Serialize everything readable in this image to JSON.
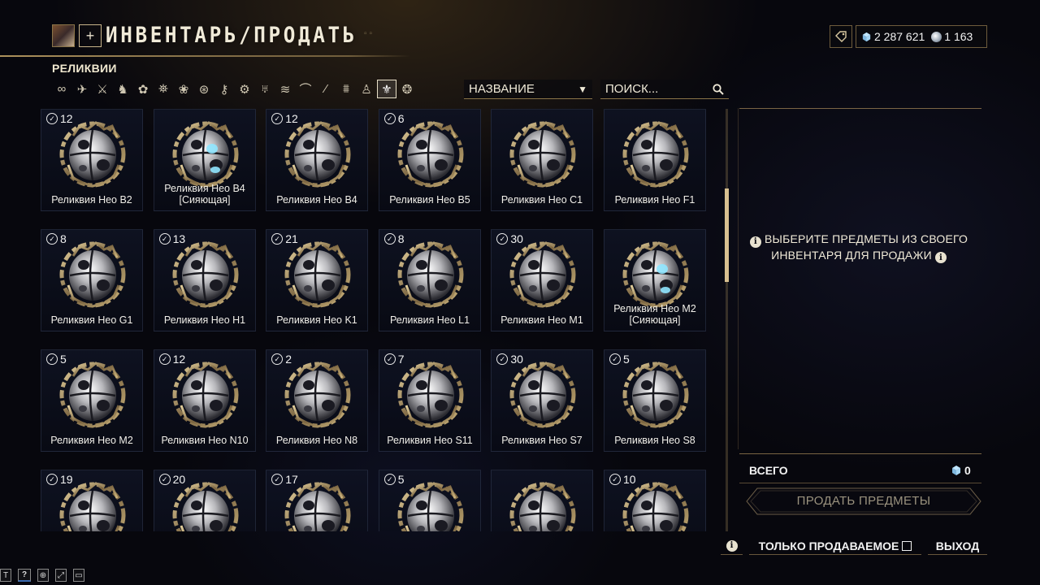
{
  "header": {
    "plus_label": "+",
    "title": "ИНВЕНТАРЬ/ПРОДАТЬ",
    "platinum": "2 287 621",
    "credits": "1 163"
  },
  "category": "РЕЛИКВИИ",
  "filters": [
    {
      "icon": "infinity-icon",
      "glyph": "∞",
      "active": false
    },
    {
      "icon": "ship-icon",
      "glyph": "✈",
      "active": false
    },
    {
      "icon": "sword-icon",
      "glyph": "⚔",
      "active": false
    },
    {
      "icon": "warframe-icon",
      "glyph": "♞",
      "active": false
    },
    {
      "icon": "creature-icon",
      "glyph": "✿",
      "active": false
    },
    {
      "icon": "vehicle-icon",
      "glyph": "⛯",
      "active": false
    },
    {
      "icon": "sentinel-icon",
      "glyph": "❀",
      "active": false
    },
    {
      "icon": "mod-icon",
      "glyph": "⊛",
      "active": false
    },
    {
      "icon": "key-icon",
      "glyph": "⚷",
      "active": false
    },
    {
      "icon": "resource-icon",
      "glyph": "⚙",
      "active": false
    },
    {
      "icon": "arcane-icon",
      "glyph": "♅",
      "active": false
    },
    {
      "icon": "fish-icon",
      "glyph": "≋",
      "active": false
    },
    {
      "icon": "bow-icon",
      "glyph": "⌒",
      "active": false
    },
    {
      "icon": "blade-icon",
      "glyph": "⁄",
      "active": false
    },
    {
      "icon": "decoration-icon",
      "glyph": "⩩",
      "active": false
    },
    {
      "icon": "figure-icon",
      "glyph": "♙",
      "active": false
    },
    {
      "icon": "relic-icon",
      "glyph": "⚜",
      "active": true
    },
    {
      "icon": "misc-icon",
      "glyph": "❂",
      "active": false
    }
  ],
  "sort": {
    "label": "НАЗВАНИЕ"
  },
  "search": {
    "placeholder": "ПОИСК..."
  },
  "items": [
    {
      "name": "Реликвия Нео B2",
      "count": "12",
      "radiant": false
    },
    {
      "name": "Реликвия Нео B4 [Сияющая]",
      "count": "",
      "radiant": true
    },
    {
      "name": "Реликвия Нео B4",
      "count": "12",
      "radiant": false
    },
    {
      "name": "Реликвия Нео B5",
      "count": "6",
      "radiant": false
    },
    {
      "name": "Реликвия Нео C1",
      "count": "",
      "radiant": false
    },
    {
      "name": "Реликвия Нео F1",
      "count": "",
      "radiant": false
    },
    {
      "name": "Реликвия Нео G1",
      "count": "8",
      "radiant": false
    },
    {
      "name": "Реликвия Нео H1",
      "count": "13",
      "radiant": false
    },
    {
      "name": "Реликвия Нео K1",
      "count": "21",
      "radiant": false
    },
    {
      "name": "Реликвия Нео L1",
      "count": "8",
      "radiant": false
    },
    {
      "name": "Реликвия Нео M1",
      "count": "30",
      "radiant": false
    },
    {
      "name": "Реликвия Нео M2 [Сияющая]",
      "count": "",
      "radiant": true
    },
    {
      "name": "Реликвия Нео M2",
      "count": "5",
      "radiant": false
    },
    {
      "name": "Реликвия Нео N10",
      "count": "12",
      "radiant": false
    },
    {
      "name": "Реликвия Нео N8",
      "count": "2",
      "radiant": false
    },
    {
      "name": "Реликвия Нео S11",
      "count": "7",
      "radiant": false
    },
    {
      "name": "Реликвия Нео S7",
      "count": "30",
      "radiant": false
    },
    {
      "name": "Реликвия Нео S8",
      "count": "5",
      "radiant": false
    },
    {
      "name": "",
      "count": "19",
      "radiant": false
    },
    {
      "name": "",
      "count": "20",
      "radiant": false
    },
    {
      "name": "",
      "count": "17",
      "radiant": false
    },
    {
      "name": "",
      "count": "5",
      "radiant": false
    },
    {
      "name": "",
      "count": "",
      "radiant": false
    },
    {
      "name": "",
      "count": "10",
      "radiant": false
    }
  ],
  "panel": {
    "hint": "ВЫБЕРИТЕ ПРЕДМЕТЫ ИЗ СВОЕГО ИНВЕНТАРЯ ДЛЯ ПРОДАЖИ",
    "total_label": "ВСЕГО",
    "total_value": "0",
    "sell_label": "ПРОДАТЬ ПРЕДМЕТЫ",
    "only_sellable_label": "ТОЛЬКО ПРОДАВАЕМОЕ",
    "exit_label": "ВЫХОД"
  },
  "taskbar": {
    "t_label": "T",
    "help_label": "?"
  },
  "colors": {
    "gold": "#c8b48a",
    "radiant": "#8fe6ff",
    "background": "#07070d"
  }
}
